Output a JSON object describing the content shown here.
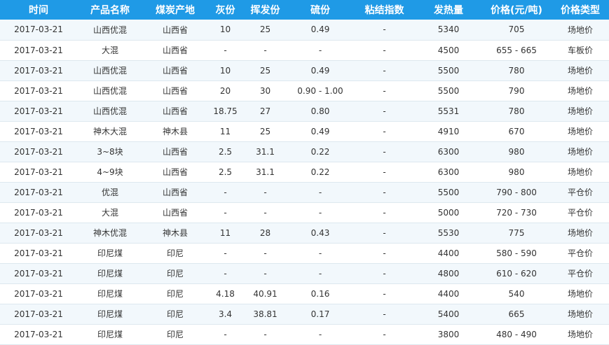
{
  "table": {
    "headers": [
      "时间",
      "产品名称",
      "煤炭产地",
      "灰份",
      "挥发份",
      "硫份",
      "粘结指数",
      "发热量",
      "价格(元/吨)",
      "价格类型"
    ],
    "rows": [
      [
        "2017-03-21",
        "山西优混",
        "山西省",
        "10",
        "25",
        "0.49",
        "-",
        "5340",
        "705",
        "场地价"
      ],
      [
        "2017-03-21",
        "大混",
        "山西省",
        "-",
        "-",
        "-",
        "-",
        "4500",
        "655 - 665",
        "车板价"
      ],
      [
        "2017-03-21",
        "山西优混",
        "山西省",
        "10",
        "25",
        "0.49",
        "-",
        "5500",
        "780",
        "场地价"
      ],
      [
        "2017-03-21",
        "山西优混",
        "山西省",
        "20",
        "30",
        "0.90 - 1.00",
        "-",
        "5500",
        "790",
        "场地价"
      ],
      [
        "2017-03-21",
        "山西优混",
        "山西省",
        "18.75",
        "27",
        "0.80",
        "-",
        "5531",
        "780",
        "场地价"
      ],
      [
        "2017-03-21",
        "神木大混",
        "神木县",
        "11",
        "25",
        "0.49",
        "-",
        "4910",
        "670",
        "场地价"
      ],
      [
        "2017-03-21",
        "3~8块",
        "山西省",
        "2.5",
        "31.1",
        "0.22",
        "-",
        "6300",
        "980",
        "场地价"
      ],
      [
        "2017-03-21",
        "4~9块",
        "山西省",
        "2.5",
        "31.1",
        "0.22",
        "-",
        "6300",
        "980",
        "场地价"
      ],
      [
        "2017-03-21",
        "优混",
        "山西省",
        "-",
        "-",
        "-",
        "-",
        "5500",
        "790 - 800",
        "平仓价"
      ],
      [
        "2017-03-21",
        "大混",
        "山西省",
        "-",
        "-",
        "-",
        "-",
        "5000",
        "720 - 730",
        "平仓价"
      ],
      [
        "2017-03-21",
        "神木优混",
        "神木县",
        "11",
        "28",
        "0.43",
        "-",
        "5530",
        "775",
        "场地价"
      ],
      [
        "2017-03-21",
        "印尼煤",
        "印尼",
        "-",
        "-",
        "-",
        "-",
        "4400",
        "580 - 590",
        "平仓价"
      ],
      [
        "2017-03-21",
        "印尼煤",
        "印尼",
        "-",
        "-",
        "-",
        "-",
        "4800",
        "610 - 620",
        "平仓价"
      ],
      [
        "2017-03-21",
        "印尼煤",
        "印尼",
        "4.18",
        "40.91",
        "0.16",
        "-",
        "4400",
        "540",
        "场地价"
      ],
      [
        "2017-03-21",
        "印尼煤",
        "印尼",
        "3.4",
        "38.81",
        "0.17",
        "-",
        "5400",
        "665",
        "场地价"
      ],
      [
        "2017-03-21",
        "印尼煤",
        "印尼",
        "-",
        "-",
        "-",
        "-",
        "3800",
        "480 - 490",
        "场地价"
      ]
    ]
  },
  "colors": {
    "header_bg": "#1f9ae6",
    "header_text": "#ffffff",
    "row_alt_bg": "#f2f8fc",
    "row_bg": "#ffffff",
    "cell_text": "#333333",
    "row_border": "#dde8ef"
  }
}
